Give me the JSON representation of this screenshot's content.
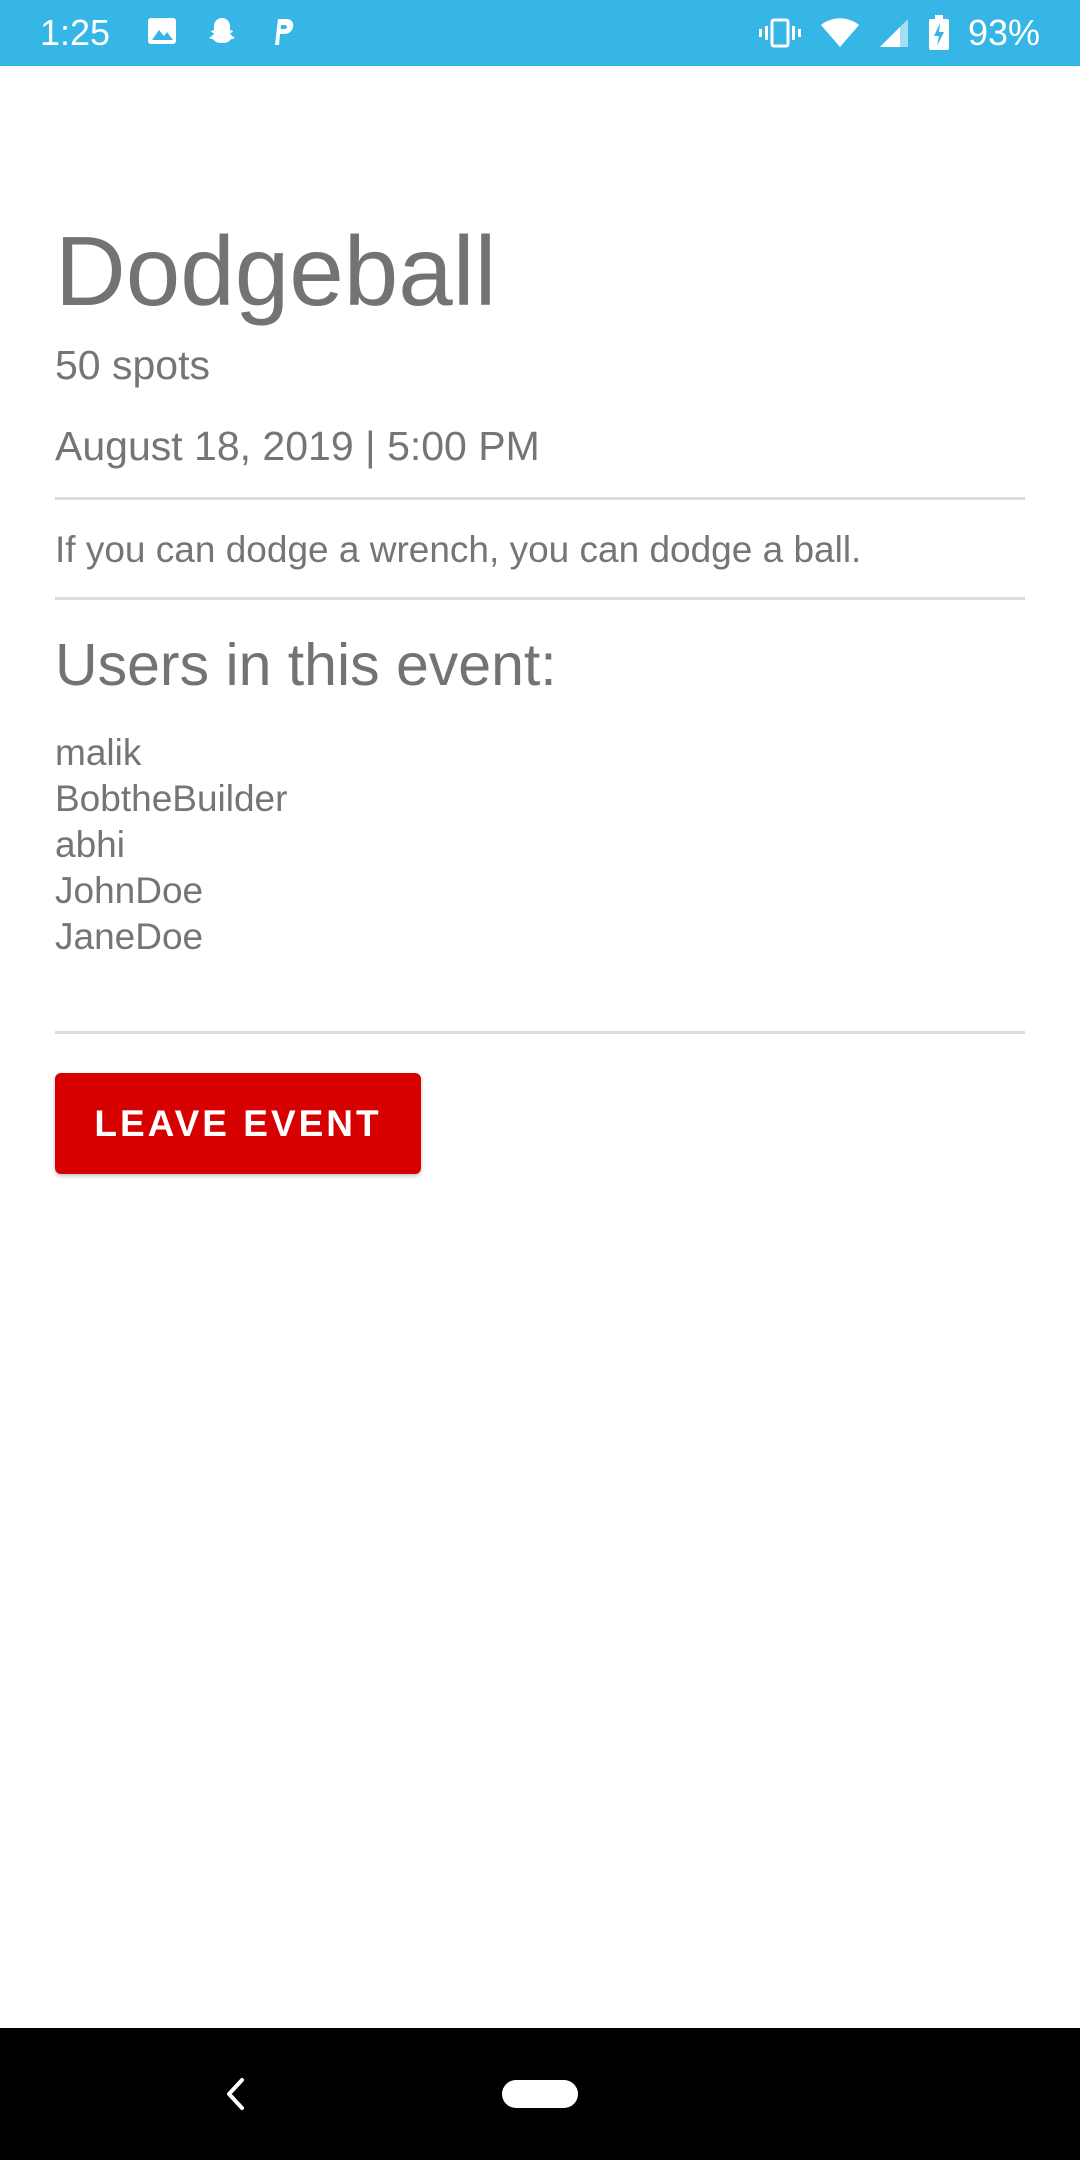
{
  "status_bar": {
    "time": "1:25",
    "battery_percent": "93%",
    "background_color": "#35b6e6",
    "left_icons": [
      "image-icon",
      "snapchat-icon",
      "parking-icon"
    ],
    "right_icons": [
      "vibrate-icon",
      "wifi-icon",
      "signal-icon",
      "battery-charging-icon"
    ]
  },
  "event": {
    "title": "Dodgeball",
    "spots": "50 spots",
    "datetime": "August 18, 2019 | 5:00 PM",
    "description": "If you can dodge a wrench, you can dodge a ball.",
    "users_heading": "Users in this event:",
    "users": [
      "malik",
      "BobtheBuilder",
      "abhi",
      "JohnDoe",
      "JaneDoe"
    ]
  },
  "actions": {
    "leave_label": "LEAVE EVENT",
    "leave_color": "#d60000"
  },
  "nav_bar": {
    "icons": [
      "back-icon",
      "home-pill-icon"
    ]
  }
}
